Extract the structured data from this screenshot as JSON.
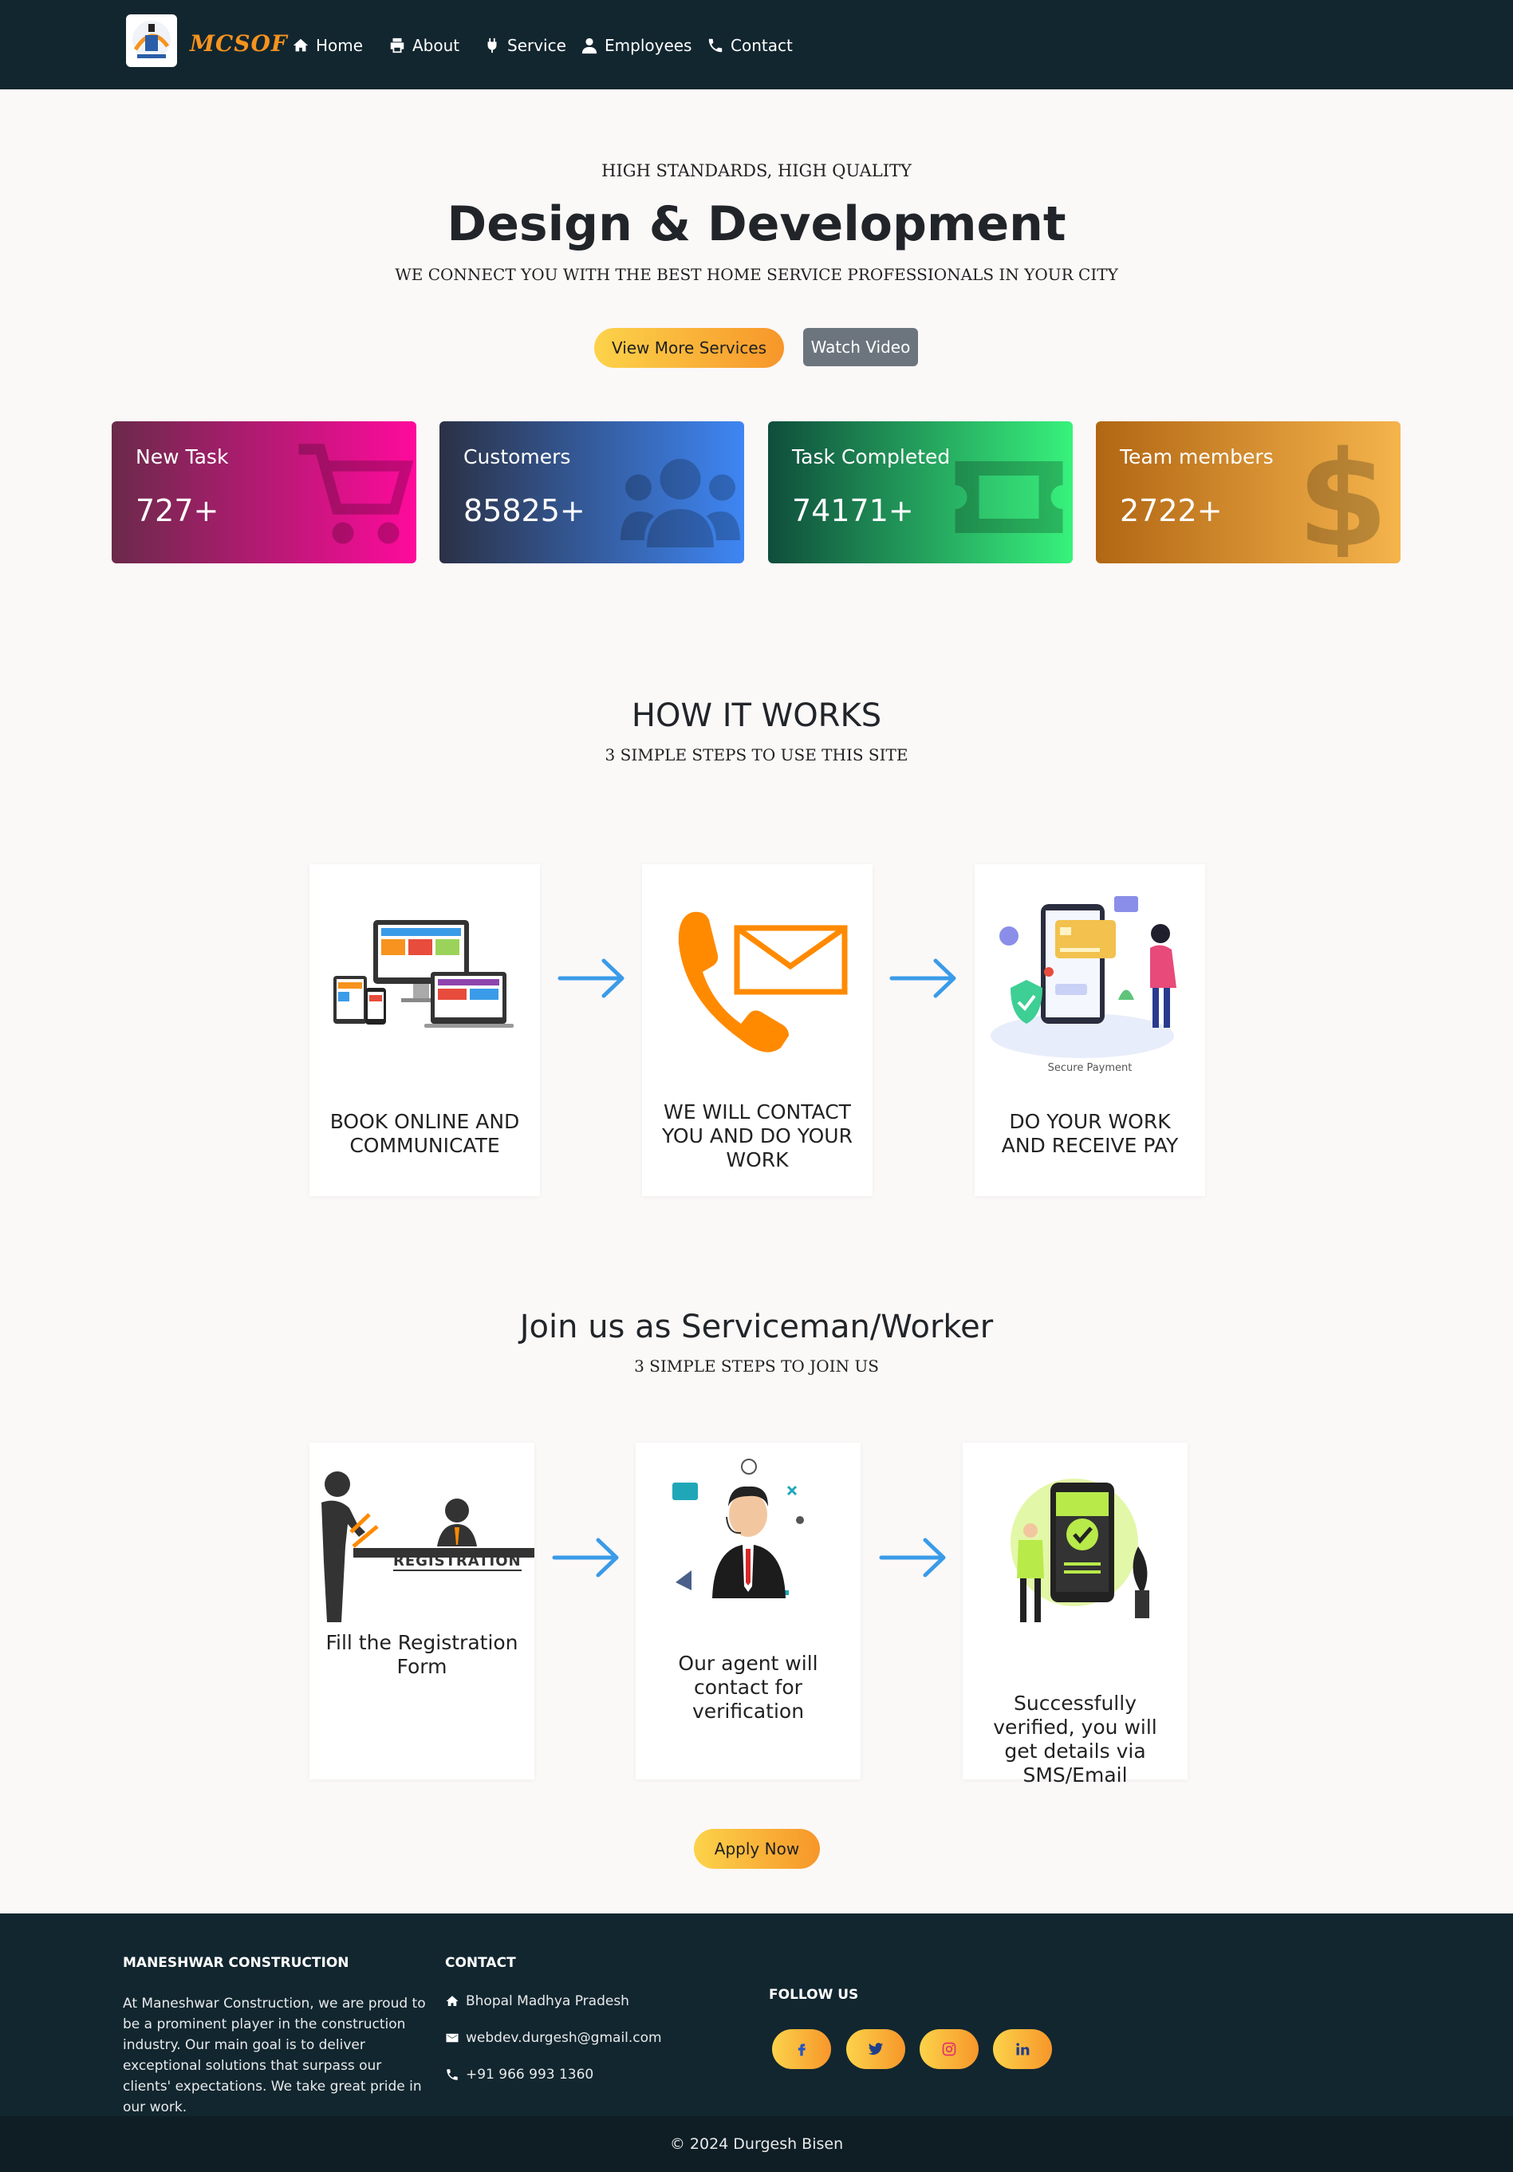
{
  "nav": {
    "brand": "MCSOF",
    "items": [
      {
        "label": "Home",
        "icon": "home-icon"
      },
      {
        "label": "About",
        "icon": "print-icon"
      },
      {
        "label": "Service",
        "icon": "plug-icon"
      },
      {
        "label": "Employees",
        "icon": "user-icon"
      },
      {
        "label": "Contact",
        "icon": "phone-icon"
      }
    ]
  },
  "hero": {
    "kicker": "HIGH STANDARDS, HIGH QUALITY",
    "title": "Design & Development",
    "subtitle": "WE CONNECT YOU WITH THE BEST HOME SERVICE PROFESSIONALS IN YOUR CITY",
    "primary_button": "View More Services",
    "secondary_button": "Watch Video"
  },
  "stats": [
    {
      "label": "New Task",
      "value": "727+",
      "icon": "cart-icon"
    },
    {
      "label": "Customers",
      "value": "85825+",
      "icon": "users-icon"
    },
    {
      "label": "Task Completed",
      "value": "74171+",
      "icon": "ticket-icon"
    },
    {
      "label": "Team members",
      "value": "2722+",
      "icon": "dollar-icon"
    }
  ],
  "how": {
    "title": "HOW IT WORKS",
    "subtitle": "3 SIMPLE STEPS TO USE THIS SITE",
    "steps": [
      {
        "text": "BOOK ONLINE AND COMMUNICATE"
      },
      {
        "text": "WE WILL CONTACT YOU AND DO YOUR WORK"
      },
      {
        "text": "DO YOUR WORK AND RECEIVE PAY",
        "image_caption": "Secure Payment"
      }
    ]
  },
  "join": {
    "title": "Join us as Serviceman/Worker",
    "subtitle": "3 SIMPLE STEPS TO JOIN US",
    "steps": [
      {
        "text": "Fill the Registration Form",
        "image_caption": "REGISTRATION"
      },
      {
        "text": "Our agent will contact for verification"
      },
      {
        "text": "Successfully verified, you will get details via SMS/Email"
      }
    ],
    "apply_button": "Apply Now"
  },
  "footer": {
    "company_heading": "MANESHWAR CONSTRUCTION",
    "company_text": "At Maneshwar Construction, we are proud to be a prominent player in the construction industry. Our main goal is to deliver exceptional solutions that surpass our clients' expectations. We take great pride in our work.",
    "contact_heading": "CONTACT",
    "address": "Bhopal Madhya Pradesh",
    "email": "webdev.durgesh@gmail.com",
    "phone": "+91 966 993 1360",
    "follow_heading": "FOLLOW US",
    "socials": [
      "facebook-icon",
      "twitter-icon",
      "instagram-icon",
      "linkedin-icon"
    ],
    "copyright": "© 2024 Durgesh Bisen"
  },
  "colors": {
    "navbar": "#12262f",
    "accent_start": "#fcd34a",
    "accent_end": "#f7962a",
    "arrow": "#3a9be8"
  }
}
